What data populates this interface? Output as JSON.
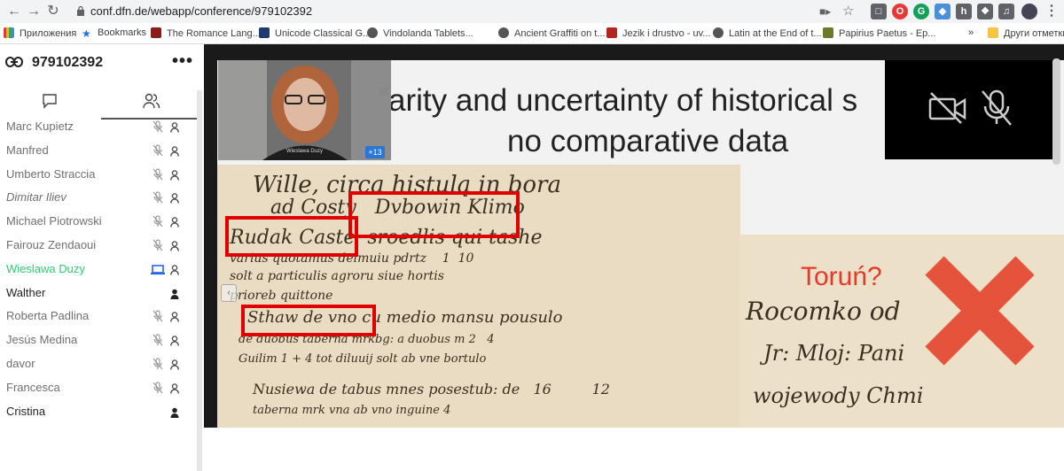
{
  "browser": {
    "url": "conf.dfn.de/webapp/conference/979102392",
    "icons": [
      "back-icon",
      "forward-icon",
      "reload-icon",
      "lock-icon",
      "camera-icon",
      "star-icon"
    ]
  },
  "bookmarks": [
    {
      "label": "Приложения",
      "icon": "apps-icon"
    },
    {
      "label": "Bookmarks",
      "icon": "star-icon"
    },
    {
      "label": "The Romance Lang...",
      "icon": "book-icon"
    },
    {
      "label": "Unicode Classical G...",
      "icon": "site-icon"
    },
    {
      "label": "Vindolanda Tablets...",
      "icon": "globe-icon"
    },
    {
      "label": "Ancient Graffiti on t...",
      "icon": "globe-icon"
    },
    {
      "label": "Jezik i drustvo - uv...",
      "icon": "leaf-icon"
    },
    {
      "label": "Latin at the End of t...",
      "icon": "globe-icon"
    },
    {
      "label": "Papirius Paetus - Ep...",
      "icon": "site-icon"
    },
    {
      "label": "»",
      "icon": ""
    },
    {
      "label": "Други отметки",
      "icon": "folder-icon"
    }
  ],
  "conference": {
    "id": "979102392",
    "participants": [
      {
        "name": "Marc Kupietz",
        "style": "normal",
        "status": "mic-off"
      },
      {
        "name": "Manfred",
        "style": "normal",
        "status": "mic-off"
      },
      {
        "name": "Umberto Straccia",
        "style": "normal",
        "status": "mic-off"
      },
      {
        "name": "Dimitar Iliev",
        "style": "italic",
        "status": "mic-off"
      },
      {
        "name": "Michael Piotrowski",
        "style": "normal",
        "status": "mic-off"
      },
      {
        "name": "Fairouz Zendaoui",
        "style": "normal",
        "status": "mic-off"
      },
      {
        "name": "Wieslawa Duzy",
        "style": "active",
        "status": "presenting"
      },
      {
        "name": "Walther",
        "style": "dark",
        "status": "moderator"
      },
      {
        "name": "Roberta Padlina",
        "style": "normal",
        "status": "mic-off"
      },
      {
        "name": "Jesús Medina",
        "style": "normal",
        "status": "mic-off"
      },
      {
        "name": "davor",
        "style": "normal",
        "status": "mic-off"
      },
      {
        "name": "Francesca",
        "style": "normal",
        "status": "mic-off"
      },
      {
        "name": "Cristina",
        "style": "dark",
        "status": "moderator"
      }
    ]
  },
  "presentation": {
    "title_line1": "arity and uncertainty of historical s",
    "title_line2": "no comparative data",
    "annotation": "Toruń?",
    "speaker_name": "Wieslawa Duzy",
    "extra_count": "+13",
    "accent_color": "#e00000",
    "annotation_color": "#e53a2a"
  }
}
